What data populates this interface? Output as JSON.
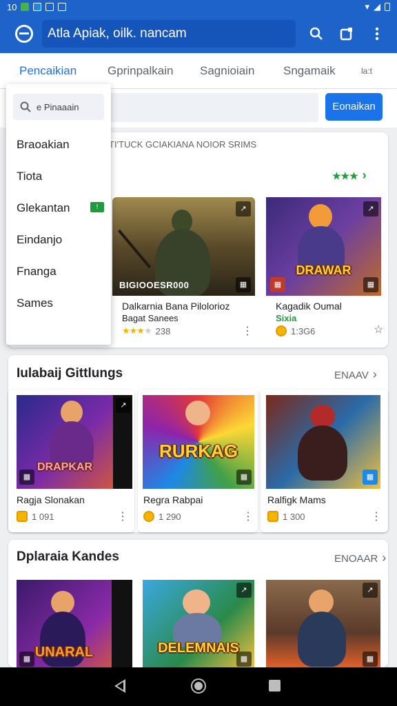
{
  "status_bar": {
    "time": "10"
  },
  "app_bar": {
    "search_text": "Atla Apiak, oilk. nancam"
  },
  "tabs": [
    "Pencaikian",
    "Gprinpalkain",
    "Sagnioiain",
    "Sngamaik",
    "la:t"
  ],
  "filter": {
    "button_label": "Eonaikan"
  },
  "dropdown": {
    "search_placeholder": "e Pinaaain",
    "items": [
      "Braoakian",
      "Tiota",
      "Glekantan",
      "Eindanjo",
      "Fnanga",
      "Sames"
    ],
    "badge": "!"
  },
  "section1": {
    "header": "TI'TUCK GCIAKIANA NOIOR SRIMS",
    "more": "★★★",
    "games": [
      {
        "overlay": "BIGIOOESR000",
        "title": "Dalkarnia Bana Pilolorioz",
        "subtitle": "Bagat Sanees",
        "rating": "238"
      },
      {
        "logo": "DRAWAR",
        "title": "Kagadik Oumal",
        "subtitle": "Sixia",
        "rating": "1:3G6"
      }
    ]
  },
  "section2": {
    "title": "Iulabaij Gittlungs",
    "more": "ENAAV",
    "games": [
      {
        "logo": "DRAPKAR",
        "title": "Ragja Slonakan",
        "rating": "1 091"
      },
      {
        "logo": "RURKAG",
        "title": "Regra Rabpai",
        "rating": "1 290"
      },
      {
        "title": "Ralfigk Mams",
        "rating": "1 300"
      }
    ]
  },
  "section3": {
    "title": "Dplaraia Kandes",
    "more": "ENOAAR",
    "games": [
      {
        "logo": "UNARAL"
      },
      {
        "logo": "DELEMNAIS"
      },
      {}
    ]
  }
}
